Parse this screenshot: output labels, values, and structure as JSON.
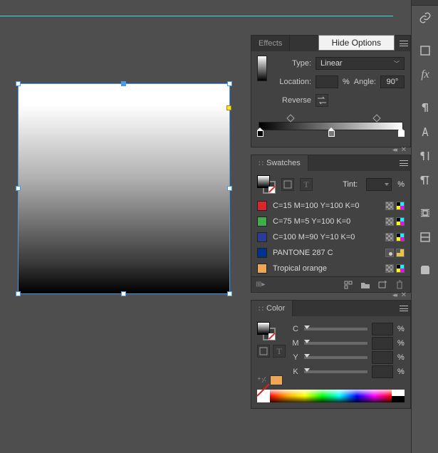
{
  "gradient_panel": {
    "tab_effects": "Effects",
    "popup": "Hide Options",
    "type_label": "Type:",
    "type_value": "Linear",
    "location_label": "Location:",
    "location_value": "",
    "pct": "%",
    "angle_label": "Angle:",
    "angle_value": "90°",
    "reverse_label": "Reverse"
  },
  "swatches": {
    "tab": "Swatches",
    "tint_label": "Tint:",
    "pct": "%",
    "items": [
      {
        "name": "C=15 M=100 Y=100 K=0",
        "color": "#d9262c",
        "icons": [
          "cross",
          "cmyk"
        ]
      },
      {
        "name": "C=75 M=5 Y=100 K=0",
        "color": "#3fae49",
        "icons": [
          "cross",
          "cmyk"
        ]
      },
      {
        "name": "C=100 M=90 Y=10 K=0",
        "color": "#2a3c98",
        "icons": [
          "cross",
          "cmyk"
        ]
      },
      {
        "name": "PANTONE 287 C",
        "color": "#00338d",
        "icons": [
          "spot",
          "global"
        ]
      },
      {
        "name": "Tropical orange",
        "color": "#eda756",
        "icons": [
          "cross",
          "cmyk"
        ]
      }
    ]
  },
  "color": {
    "tab": "Color",
    "channels": [
      "C",
      "M",
      "Y",
      "K"
    ],
    "pct": "%"
  }
}
